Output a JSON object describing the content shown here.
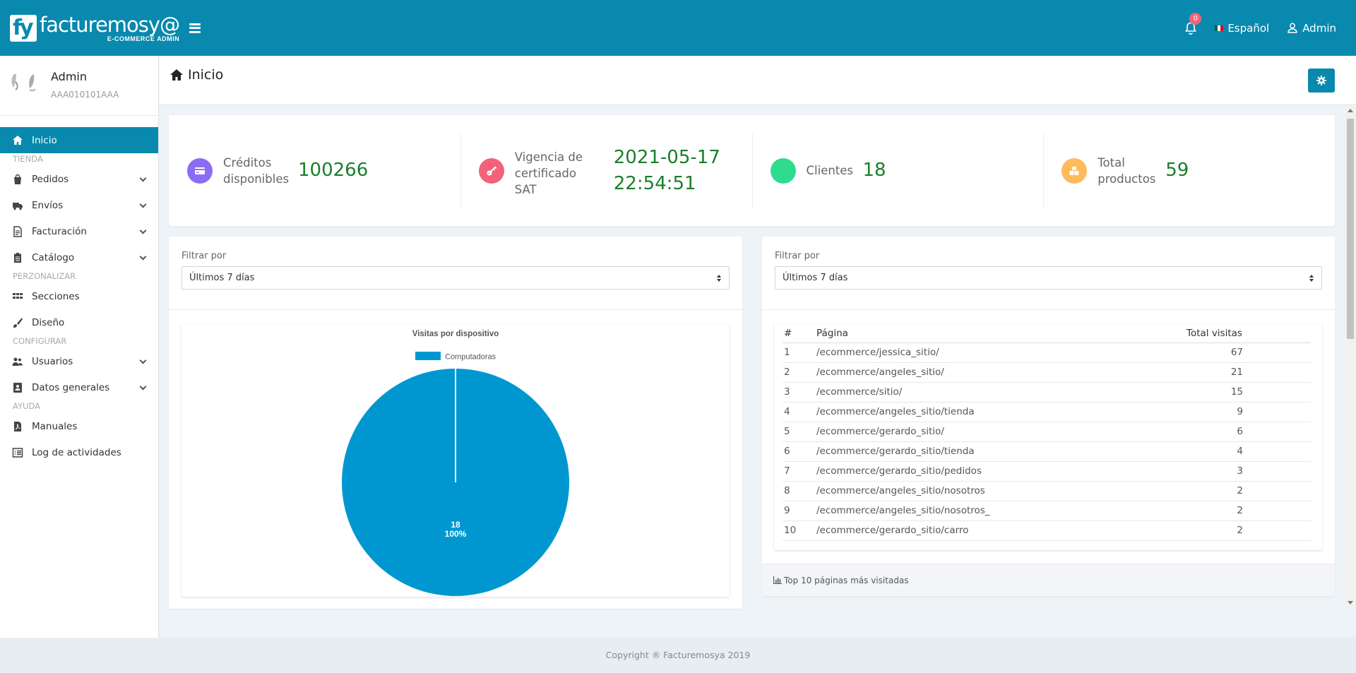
{
  "brand": {
    "logo_mark": "fy",
    "name": "facturemosy@",
    "tagline": "E-COMMERCE ADMIN"
  },
  "topbar": {
    "notifications_count": "0",
    "language": "Español",
    "user": "Admin"
  },
  "profile": {
    "name": "Admin",
    "rfc": "AAA010101AAA"
  },
  "sidebar": {
    "items": [
      {
        "type": "item",
        "label": "Inicio",
        "icon": "home-icon",
        "active": true
      },
      {
        "type": "section",
        "label": "TIENDA"
      },
      {
        "type": "item",
        "label": "Pedidos",
        "icon": "shopping-bag-icon",
        "expandable": true
      },
      {
        "type": "item",
        "label": "Envíos",
        "icon": "truck-icon",
        "expandable": true
      },
      {
        "type": "item",
        "label": "Facturación",
        "icon": "invoice-icon",
        "expandable": true
      },
      {
        "type": "item",
        "label": "Catálogo",
        "icon": "clipboard-icon",
        "expandable": true
      },
      {
        "type": "section",
        "label": "PERZONALIZAR"
      },
      {
        "type": "item",
        "label": "Secciones",
        "icon": "grid-icon"
      },
      {
        "type": "item",
        "label": "Diseño",
        "icon": "brush-icon"
      },
      {
        "type": "section",
        "label": "CONFIGURAR"
      },
      {
        "type": "item",
        "label": "Usuarios",
        "icon": "users-icon",
        "expandable": true
      },
      {
        "type": "item",
        "label": "Datos generales",
        "icon": "address-card-icon",
        "expandable": true
      },
      {
        "type": "section",
        "label": "AYUDA"
      },
      {
        "type": "item",
        "label": "Manuales",
        "icon": "pdf-file-icon"
      },
      {
        "type": "item",
        "label": "Log de actividades",
        "icon": "list-icon"
      }
    ]
  },
  "page": {
    "title": "Inicio"
  },
  "stats": [
    {
      "label_lines": [
        "Créditos",
        "disponibles"
      ],
      "value_lines": [
        "100266"
      ],
      "icon": "credit-card-icon",
      "color": "#8b6cf2"
    },
    {
      "label_lines": [
        "Vigencia de",
        "certificado",
        "SAT"
      ],
      "value_lines": [
        "2021-05-17",
        "22:54:51"
      ],
      "icon": "key-icon",
      "color": "#f2637a"
    },
    {
      "label_lines": [
        "Clientes"
      ],
      "value_lines": [
        "18"
      ],
      "icon": "users-icon",
      "color": "#2edc8f"
    },
    {
      "label_lines": [
        "Total",
        "productos"
      ],
      "value_lines": [
        "59"
      ],
      "icon": "boxes-icon",
      "color": "#fdbb5a"
    }
  ],
  "filters": {
    "left": {
      "label": "Filtrar por",
      "value": "Últimos 7 días"
    },
    "right": {
      "label": "Filtrar por",
      "value": "Últimos 7 días"
    }
  },
  "chart_data": {
    "type": "pie",
    "title": "Visitas por dispositivo",
    "categories": [
      "Computadoras"
    ],
    "values": [
      18
    ],
    "percent_labels": [
      "100%"
    ],
    "colors": [
      "#0097d1"
    ],
    "legend": "top"
  },
  "pages_table": {
    "columns": [
      "#",
      "Página",
      "Total visitas"
    ],
    "rows": [
      [
        "1",
        "/ecommerce/jessica_sitio/",
        "67"
      ],
      [
        "2",
        "/ecommerce/angeles_sitio/",
        "21"
      ],
      [
        "3",
        "/ecommerce/sitio/",
        "15"
      ],
      [
        "4",
        "/ecommerce/angeles_sitio/tienda",
        "9"
      ],
      [
        "5",
        "/ecommerce/gerardo_sitio/",
        "6"
      ],
      [
        "6",
        "/ecommerce/gerardo_sitio/tienda",
        "4"
      ],
      [
        "7",
        "/ecommerce/gerardo_sitio/pedidos",
        "3"
      ],
      [
        "8",
        "/ecommerce/angeles_sitio/nosotros",
        "2"
      ],
      [
        "9",
        "/ecommerce/angeles_sitio/nosotros_",
        "2"
      ],
      [
        "10",
        "/ecommerce/gerardo_sitio/carro",
        "2"
      ]
    ],
    "footer": "Top 10 páginas más visitadas"
  },
  "footer": {
    "copyright": "Copyright ® Facturemosya 2019"
  },
  "colors": {
    "primary": "#0989ad",
    "value_green": "#1a7f2a",
    "badge": "#f2637a"
  }
}
